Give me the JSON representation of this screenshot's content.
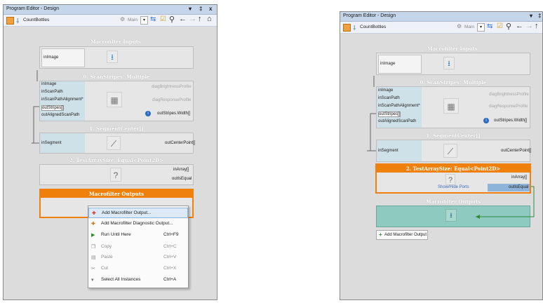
{
  "left": {
    "window_title": "Program Editor - Design",
    "title_controls": [
      "▾",
      "‡",
      "x"
    ],
    "program_name": "CountBottles",
    "view_select": "Main",
    "macro_inputs": {
      "title": "Macrofilter Inputs",
      "port": "inImage"
    },
    "scan": {
      "title": "0. ScanStripes: Multiple",
      "inputs": [
        "inImage",
        "inScanPath",
        "inScanPathAlignment*",
        "outStripes[]",
        "outAlignedScanPath"
      ],
      "outputs": [
        "diagBrightnessProfile",
        "diagResponseProfile",
        "outStripes.Width[]"
      ]
    },
    "segment": {
      "title": "1. SegmentCenter[]",
      "input": "inSegment",
      "output": "outCenterPoint[]"
    },
    "testarray": {
      "title": "2. TestArraySize: Equal<Point2D>",
      "outputs": [
        "inArray[]",
        "outIsEqual"
      ]
    },
    "macro_outputs": {
      "title": "Macrofilter Outputs"
    },
    "context_menu": [
      {
        "label": "Add Macrofilter Output...",
        "shortcut": "",
        "icon": "add-output-icon",
        "disabled": false,
        "highlight": true
      },
      {
        "label": "Add Macrofilter Diagnostic Output...",
        "shortcut": "",
        "icon": "add-diagnostic-output-icon",
        "disabled": false,
        "highlight": false
      },
      {
        "label": "Run Until Here",
        "shortcut": "Ctrl+F9",
        "icon": "run-until-here-icon",
        "disabled": false,
        "highlight": false
      },
      {
        "label": "Copy",
        "shortcut": "Ctrl+C",
        "icon": "copy-icon",
        "disabled": true,
        "highlight": false
      },
      {
        "label": "Paste",
        "shortcut": "Ctrl+V",
        "icon": "paste-icon",
        "disabled": true,
        "highlight": false
      },
      {
        "label": "Cut",
        "shortcut": "Ctrl+X",
        "icon": "cut-icon",
        "disabled": true,
        "highlight": false
      },
      {
        "label": "Select All Instances",
        "shortcut": "Ctrl+A",
        "icon": "select-all-icon",
        "disabled": false,
        "highlight": false
      }
    ]
  },
  "right": {
    "window_title": "Program Editor - Design",
    "title_controls": [
      "▾",
      "‡"
    ],
    "program_name": "CountBottles",
    "view_select": "Main",
    "macro_inputs": {
      "title": "Macrofilter Inputs",
      "port": "inImage"
    },
    "scan": {
      "title": "0. ScanStripes: Multiple",
      "inputs": [
        "inImage",
        "inScanPath",
        "inScanPathAlignment*",
        "outStripes[]",
        "outAlignedScanPath"
      ],
      "outputs": [
        "diagBrightnessProfile",
        "diagResponseProfile",
        "outStripes.Width[]"
      ]
    },
    "segment": {
      "title": "1. SegmentCenter[]",
      "input": "inSegment",
      "output": "outCenterPoint[]"
    },
    "testarray": {
      "title": "2. TestArraySize: Equal<Point2D>",
      "outputs": [
        "inArray[]",
        "outIsEqual"
      ],
      "show_hide": "Show/Hide Ports"
    },
    "macro_outputs": {
      "title": "Macrofilter Outputs"
    },
    "add_output_button": "Add Macrofilter Output"
  },
  "colors": {
    "accent_orange": "#f0800c",
    "node_header": "#b9b9b9",
    "port_blue": "#cfe1e8",
    "selected_blue": "#8fb4d9",
    "link_green": "#2f8a3a",
    "output_fill": "#8fcac0"
  }
}
